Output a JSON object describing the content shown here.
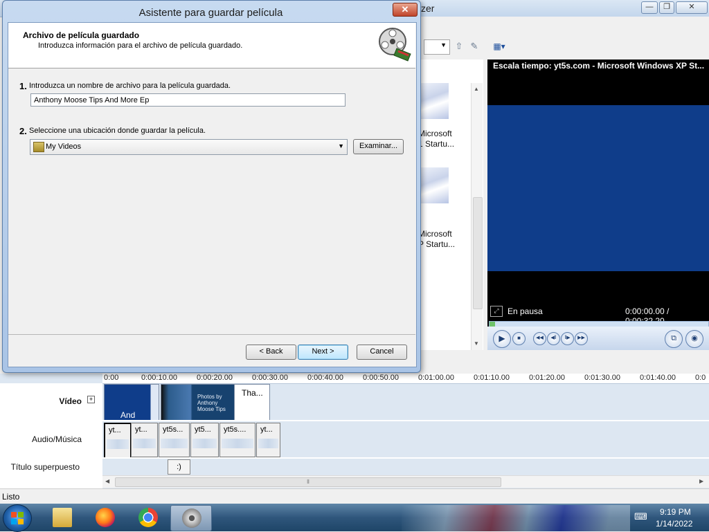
{
  "background_app": {
    "title_fragment": "zer",
    "window_buttons": [
      "—",
      "❐",
      "✕"
    ],
    "collections": [
      {
        "line1": "Microsoft",
        "line2": "1 Startu..."
      },
      {
        "line1": "Microsoft",
        "line2": "P Startu..."
      }
    ],
    "monitor": {
      "title": "Escala tiempo: yt5s.com - Microsoft Windows XP St...",
      "status": "En pausa",
      "time": "0:00:00.00 / 0:00:32.20",
      "progress_fraction": 0.0
    },
    "timeline": {
      "ruler_ticks": [
        "0:00",
        "0:00:10.00",
        "0:00:20.00",
        "0:00:30.00",
        "0:00:40.00",
        "0:00:50.00",
        "0:01:00.00",
        "0:01:10.00",
        "0:01:20.00",
        "0:01:30.00",
        "0:01:40.00",
        "0:0"
      ],
      "track_video_label": "Vídeo",
      "track_audio_label": "Audio/Música",
      "track_title_label": "Título superpuesto",
      "expand_symbol": "+",
      "video_clips": [
        {
          "text": "And"
        },
        {
          "text": "Photos by Anthony Moose Tips"
        },
        {
          "text": "Tha..."
        }
      ],
      "audio_clips": [
        "yt...",
        "yt...",
        "yt5s...",
        "yt5...",
        "yt5s....",
        "yt..."
      ],
      "title_clip": ":)"
    },
    "status_bar": "Listo"
  },
  "dialog": {
    "title": "Asistente para guardar película",
    "close_label": "✕",
    "header_title": "Archivo de película guardado",
    "header_subtitle": "Introduzca información para el archivo de película guardado.",
    "step1_number": "1.",
    "step1_text": "Introduzca un nombre de archivo para la película guardada.",
    "filename_value": "Anthony Moose Tips And More Ep",
    "step2_number": "2.",
    "step2_text": "Seleccione una ubicación donde guardar la película.",
    "location_value": "My Videos",
    "browse_label": "Examinar...",
    "back_label": "< Back",
    "next_label": "Next >",
    "cancel_label": "Cancel"
  },
  "taskbar": {
    "apps": [
      "start-menu",
      "file-explorer",
      "firefox",
      "chrome",
      "windows-movie-maker"
    ],
    "clock_time": "9:19 PM",
    "clock_date": "1/14/2022"
  }
}
